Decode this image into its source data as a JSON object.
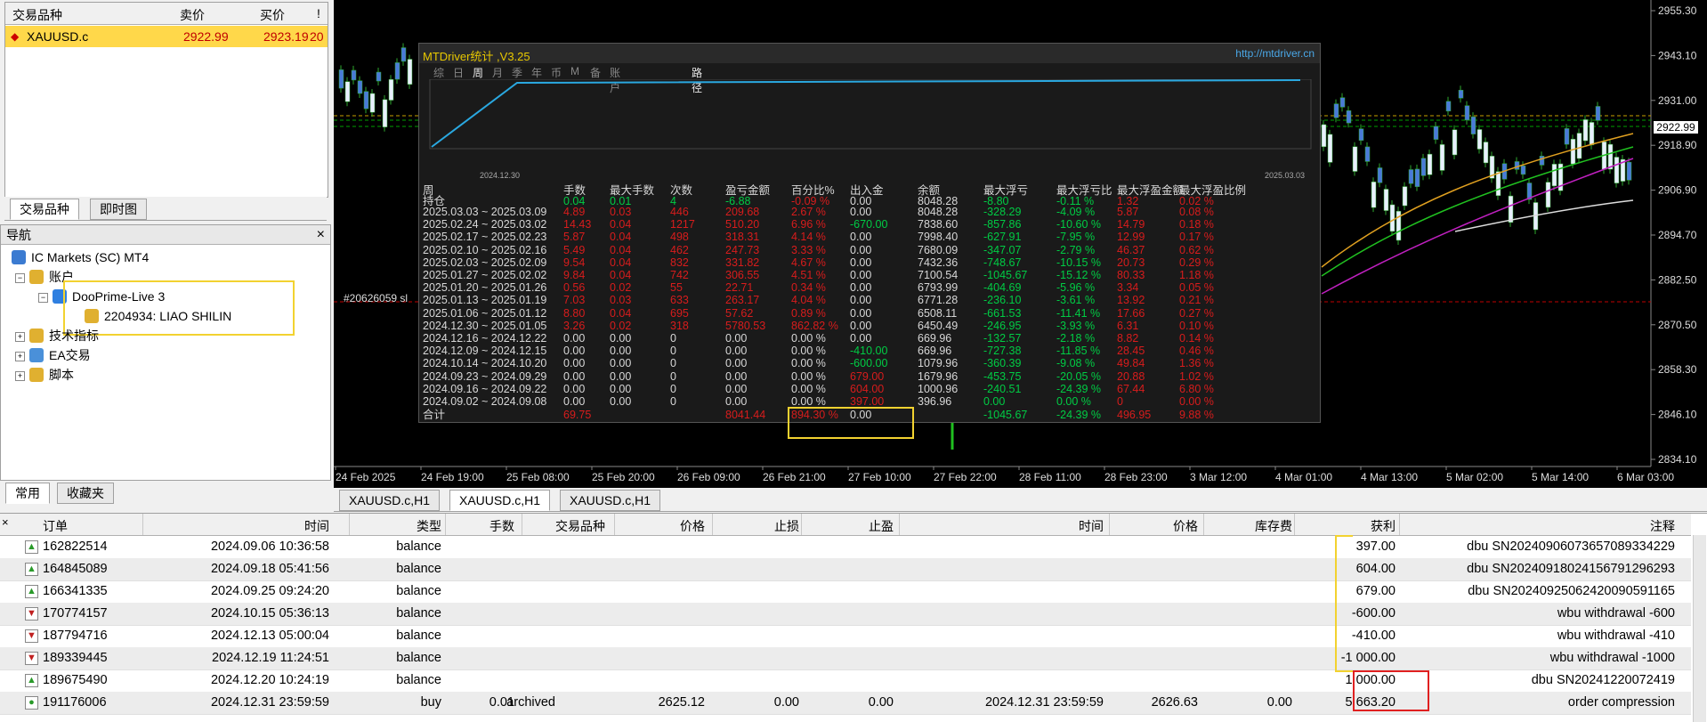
{
  "market_watch": {
    "headers": [
      "交易品种",
      "卖价",
      "买价",
      "!"
    ],
    "row": {
      "symbol": "XAUUSD.c",
      "bid": "2922.99",
      "ask": "2923.19",
      "spread": "20"
    },
    "tabs": [
      "交易品种",
      "即时图"
    ]
  },
  "navigator": {
    "title": "导航",
    "close": "×",
    "items": [
      "IC Markets (SC) MT4",
      "账户",
      "DooPrime-Live 3",
      "2204934: LIAO SHILIN",
      "技术指标",
      "EA交易",
      "脚本"
    ],
    "tabs": [
      "常用",
      "收藏夹"
    ]
  },
  "chart": {
    "price_labels": [
      "2955.30",
      "2943.10",
      "2931.00",
      "2918.90",
      "2906.90",
      "2894.70",
      "2882.50",
      "2870.50",
      "2858.30",
      "2846.10",
      "2834.10"
    ],
    "current_price": "2922.99",
    "time_labels": [
      "24 Feb 2025",
      "24 Feb 19:00",
      "25 Feb 08:00",
      "25 Feb 20:00",
      "26 Feb 09:00",
      "26 Feb 21:00",
      "27 Feb 10:00",
      "27 Feb 22:00",
      "28 Feb 11:00",
      "28 Feb 23:00",
      "3 Mar 12:00",
      "4 Mar 01:00",
      "4 Mar 13:00",
      "5 Mar 02:00",
      "5 Mar 14:00",
      "6 Mar 03:00"
    ],
    "order_label": "#20626059 sl",
    "tabs": [
      "XAUUSD.c,H1",
      "XAUUSD.c,H1",
      "XAUUSD.c,H1"
    ]
  },
  "mtdriver": {
    "title": "MTDriver统计 ,V3.25",
    "url": "http://mtdriver.cn",
    "period_tabs": [
      "综",
      "日",
      "周",
      "月",
      "季",
      "年",
      "币",
      "M",
      "备",
      "账户",
      "路径"
    ],
    "graph_start": "2024.12.30",
    "graph_end": "2025.03.03",
    "columns": [
      "周",
      "手数",
      "最大手数",
      "次数",
      "盈亏金额",
      "百分比%",
      "出入金",
      "余额",
      "最大浮亏",
      "最大浮亏比",
      "最大浮盈金额",
      "最大浮盈比例"
    ],
    "holding": {
      "label": "持仓",
      "lots": "0.04",
      "max_lots": "0.01",
      "count": "4",
      "pl": "-6.88",
      "pct": "-0.09 %",
      "io": "0.00",
      "balance": "8048.28",
      "max_dd": "-8.80",
      "max_dd_pct": "-0.11 %",
      "max_fp": "1.32",
      "max_fp_pct": "0.02 %"
    },
    "rows": [
      {
        "week": "2025.03.03 ~ 2025.03.09",
        "lots": "4.89",
        "max_lots": "0.03",
        "count": "446",
        "pl": "209.68",
        "pct": "2.67 %",
        "io": "0.00",
        "balance": "8048.28",
        "max_dd": "-328.29",
        "max_dd_pct": "-4.09 %",
        "max_fp": "5.87",
        "max_fp_pct": "0.08 %"
      },
      {
        "week": "2025.02.24 ~ 2025.03.02",
        "lots": "14.43",
        "max_lots": "0.04",
        "count": "1217",
        "pl": "510.20",
        "pct": "6.96 %",
        "io": "-670.00",
        "balance": "7838.60",
        "max_dd": "-857.86",
        "max_dd_pct": "-10.60 %",
        "max_fp": "14.79",
        "max_fp_pct": "0.18 %"
      },
      {
        "week": "2025.02.17 ~ 2025.02.23",
        "lots": "5.87",
        "max_lots": "0.04",
        "count": "498",
        "pl": "318.31",
        "pct": "4.14 %",
        "io": "0.00",
        "balance": "7998.40",
        "max_dd": "-627.91",
        "max_dd_pct": "-7.95 %",
        "max_fp": "12.99",
        "max_fp_pct": "0.17 %"
      },
      {
        "week": "2025.02.10 ~ 2025.02.16",
        "lots": "5.49",
        "max_lots": "0.04",
        "count": "462",
        "pl": "247.73",
        "pct": "3.33 %",
        "io": "0.00",
        "balance": "7680.09",
        "max_dd": "-347.07",
        "max_dd_pct": "-2.79 %",
        "max_fp": "46.37",
        "max_fp_pct": "0.62 %"
      },
      {
        "week": "2025.02.03 ~ 2025.02.09",
        "lots": "9.54",
        "max_lots": "0.04",
        "count": "832",
        "pl": "331.82",
        "pct": "4.67 %",
        "io": "0.00",
        "balance": "7432.36",
        "max_dd": "-748.67",
        "max_dd_pct": "-10.15 %",
        "max_fp": "20.73",
        "max_fp_pct": "0.29 %"
      },
      {
        "week": "2025.01.27 ~ 2025.02.02",
        "lots": "9.84",
        "max_lots": "0.04",
        "count": "742",
        "pl": "306.55",
        "pct": "4.51 %",
        "io": "0.00",
        "balance": "7100.54",
        "max_dd": "-1045.67",
        "max_dd_pct": "-15.12 %",
        "max_fp": "80.33",
        "max_fp_pct": "1.18 %"
      },
      {
        "week": "2025.01.20 ~ 2025.01.26",
        "lots": "0.56",
        "max_lots": "0.02",
        "count": "55",
        "pl": "22.71",
        "pct": "0.34 %",
        "io": "0.00",
        "balance": "6793.99",
        "max_dd": "-404.69",
        "max_dd_pct": "-5.96 %",
        "max_fp": "3.34",
        "max_fp_pct": "0.05 %"
      },
      {
        "week": "2025.01.13 ~ 2025.01.19",
        "lots": "7.03",
        "max_lots": "0.03",
        "count": "633",
        "pl": "263.17",
        "pct": "4.04 %",
        "io": "0.00",
        "balance": "6771.28",
        "max_dd": "-236.10",
        "max_dd_pct": "-3.61 %",
        "max_fp": "13.92",
        "max_fp_pct": "0.21 %"
      },
      {
        "week": "2025.01.06 ~ 2025.01.12",
        "lots": "8.80",
        "max_lots": "0.04",
        "count": "695",
        "pl": "57.62",
        "pct": "0.89 %",
        "io": "0.00",
        "balance": "6508.11",
        "max_dd": "-661.53",
        "max_dd_pct": "-11.41 %",
        "max_fp": "17.66",
        "max_fp_pct": "0.27 %"
      },
      {
        "week": "2024.12.30 ~ 2025.01.05",
        "lots": "3.26",
        "max_lots": "0.02",
        "count": "318",
        "pl": "5780.53",
        "pct": "862.82 %",
        "io": "0.00",
        "balance": "6450.49",
        "max_dd": "-246.95",
        "max_dd_pct": "-3.93 %",
        "max_fp": "6.31",
        "max_fp_pct": "0.10 %"
      },
      {
        "week": "2024.12.16 ~ 2024.12.22",
        "lots": "0.00",
        "max_lots": "0.00",
        "count": "0",
        "pl": "0.00",
        "pct": "0.00 %",
        "io": "0.00",
        "balance": "669.96",
        "max_dd": "-132.57",
        "max_dd_pct": "-2.18 %",
        "max_fp": "8.82",
        "max_fp_pct": "0.14 %"
      },
      {
        "week": "2024.12.09 ~ 2024.12.15",
        "lots": "0.00",
        "max_lots": "0.00",
        "count": "0",
        "pl": "0.00",
        "pct": "0.00 %",
        "io": "-410.00",
        "balance": "669.96",
        "max_dd": "-727.38",
        "max_dd_pct": "-11.85 %",
        "max_fp": "28.45",
        "max_fp_pct": "0.46 %"
      },
      {
        "week": "2024.10.14 ~ 2024.10.20",
        "lots": "0.00",
        "max_lots": "0.00",
        "count": "0",
        "pl": "0.00",
        "pct": "0.00 %",
        "io": "-600.00",
        "balance": "1079.96",
        "max_dd": "-360.39",
        "max_dd_pct": "-9.08 %",
        "max_fp": "49.84",
        "max_fp_pct": "1.36 %"
      },
      {
        "week": "2024.09.23 ~ 2024.09.29",
        "lots": "0.00",
        "max_lots": "0.00",
        "count": "0",
        "pl": "0.00",
        "pct": "0.00 %",
        "io": "679.00",
        "balance": "1679.96",
        "max_dd": "-453.75",
        "max_dd_pct": "-20.05 %",
        "max_fp": "20.88",
        "max_fp_pct": "1.02 %"
      },
      {
        "week": "2024.09.16 ~ 2024.09.22",
        "lots": "0.00",
        "max_lots": "0.00",
        "count": "0",
        "pl": "0.00",
        "pct": "0.00 %",
        "io": "604.00",
        "balance": "1000.96",
        "max_dd": "-240.51",
        "max_dd_pct": "-24.39 %",
        "max_fp": "67.44",
        "max_fp_pct": "6.80 %"
      },
      {
        "week": "2024.09.02 ~ 2024.09.08",
        "lots": "0.00",
        "max_lots": "0.00",
        "count": "0",
        "pl": "0.00",
        "pct": "0.00 %",
        "io": "397.00",
        "balance": "396.96",
        "max_dd": "0.00",
        "max_dd_pct": "0.00 %",
        "max_fp": "0",
        "max_fp_pct": "0.00 %"
      }
    ],
    "total": {
      "label": "合计",
      "lots": "69.75",
      "pl": "8041.44",
      "pct": "894.30 %",
      "io": "0.00",
      "max_dd": "-1045.67",
      "max_dd_pct": "-24.39 %",
      "max_fp": "496.95",
      "max_fp_pct": "9.88 %"
    }
  },
  "terminal": {
    "headers": [
      "订单",
      "时间",
      "类型",
      "手数",
      "交易品种",
      "价格",
      "止损",
      "止盈",
      "时间",
      "价格",
      "库存费",
      "获利",
      "注释"
    ],
    "rows": [
      {
        "dir": "up",
        "order": "162822514",
        "time": "2024.09.06 10:36:58",
        "type": "balance",
        "lots": "",
        "symbol": "",
        "price": "",
        "sl": "",
        "tp": "",
        "ctime": "",
        "cprice": "",
        "swap": "",
        "profit": "397.00",
        "comment": "dbu SN20240906073657089334229"
      },
      {
        "dir": "up",
        "order": "164845089",
        "time": "2024.09.18 05:41:56",
        "type": "balance",
        "lots": "",
        "symbol": "",
        "price": "",
        "sl": "",
        "tp": "",
        "ctime": "",
        "cprice": "",
        "swap": "",
        "profit": "604.00",
        "comment": "dbu SN20240918024156791296293"
      },
      {
        "dir": "up",
        "order": "166341335",
        "time": "2024.09.25 09:24:20",
        "type": "balance",
        "lots": "",
        "symbol": "",
        "price": "",
        "sl": "",
        "tp": "",
        "ctime": "",
        "cprice": "",
        "swap": "",
        "profit": "679.00",
        "comment": "dbu SN20240925062420090591165"
      },
      {
        "dir": "dn",
        "order": "170774157",
        "time": "2024.10.15 05:36:13",
        "type": "balance",
        "lots": "",
        "symbol": "",
        "price": "",
        "sl": "",
        "tp": "",
        "ctime": "",
        "cprice": "",
        "swap": "",
        "profit": "-600.00",
        "comment": "wbu withdrawal -600"
      },
      {
        "dir": "dn",
        "order": "187794716",
        "time": "2024.12.13 05:00:04",
        "type": "balance",
        "lots": "",
        "symbol": "",
        "price": "",
        "sl": "",
        "tp": "",
        "ctime": "",
        "cprice": "",
        "swap": "",
        "profit": "-410.00",
        "comment": "wbu withdrawal -410"
      },
      {
        "dir": "dn",
        "order": "189339445",
        "time": "2024.12.19 11:24:51",
        "type": "balance",
        "lots": "",
        "symbol": "",
        "price": "",
        "sl": "",
        "tp": "",
        "ctime": "",
        "cprice": "",
        "swap": "",
        "profit": "-1 000.00",
        "comment": "wbu withdrawal -1000"
      },
      {
        "dir": "up",
        "order": "189675490",
        "time": "2024.12.20 10:24:19",
        "type": "balance",
        "lots": "",
        "symbol": "",
        "price": "",
        "sl": "",
        "tp": "",
        "ctime": "",
        "cprice": "",
        "swap": "",
        "profit": "1 000.00",
        "comment": "dbu SN20241220072419"
      },
      {
        "dir": "buy",
        "order": "191176006",
        "time": "2024.12.31 23:59:59",
        "type": "buy",
        "lots": "0.01",
        "symbol": "archived",
        "price": "2625.12",
        "sl": "0.00",
        "tp": "0.00",
        "ctime": "2024.12.31 23:59:59",
        "cprice": "2626.63",
        "swap": "0.00",
        "profit": "5 663.20",
        "comment": "order compression"
      }
    ]
  }
}
